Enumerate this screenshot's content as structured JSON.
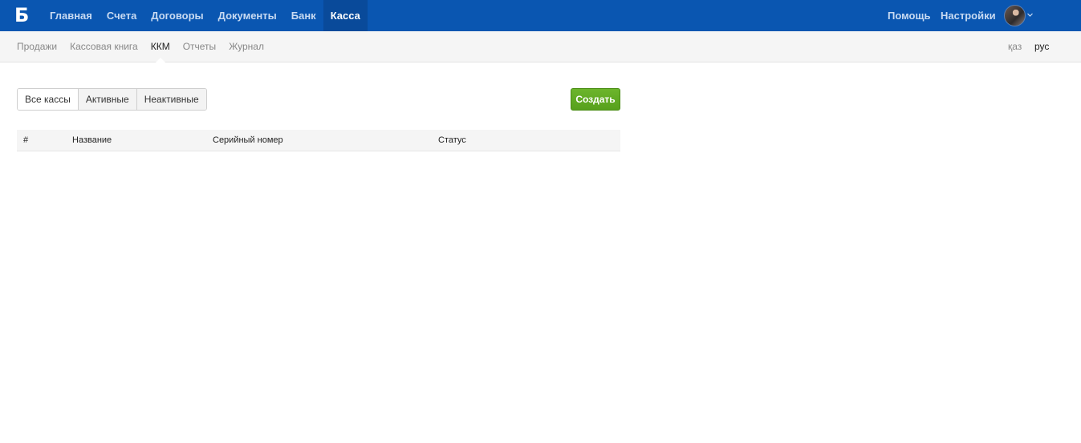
{
  "logo": {
    "text": "Б"
  },
  "top_nav": {
    "items": [
      {
        "label": "Главная"
      },
      {
        "label": "Счета"
      },
      {
        "label": "Договоры"
      },
      {
        "label": "Документы"
      },
      {
        "label": "Банк"
      },
      {
        "label": "Касса",
        "active": true
      }
    ],
    "help": "Помощь",
    "settings": "Настройки"
  },
  "sub_nav": {
    "items": [
      {
        "label": "Продажи"
      },
      {
        "label": "Кассовая книга"
      },
      {
        "label": "ККМ",
        "active": true
      },
      {
        "label": "Отчеты"
      },
      {
        "label": "Журнал"
      }
    ],
    "lang_kaz": "қаз",
    "lang_rus": "рус"
  },
  "filters": {
    "all": "Все кассы",
    "active": "Активные",
    "inactive": "Неактивные"
  },
  "create_button": "Создать",
  "table": {
    "columns": [
      "#",
      "Название",
      "Серийный номер",
      "Статус"
    ],
    "rows": []
  },
  "colors": {
    "topbar": "#0a56b1",
    "active_tab": "#094a9a",
    "create": "#5fa923"
  }
}
